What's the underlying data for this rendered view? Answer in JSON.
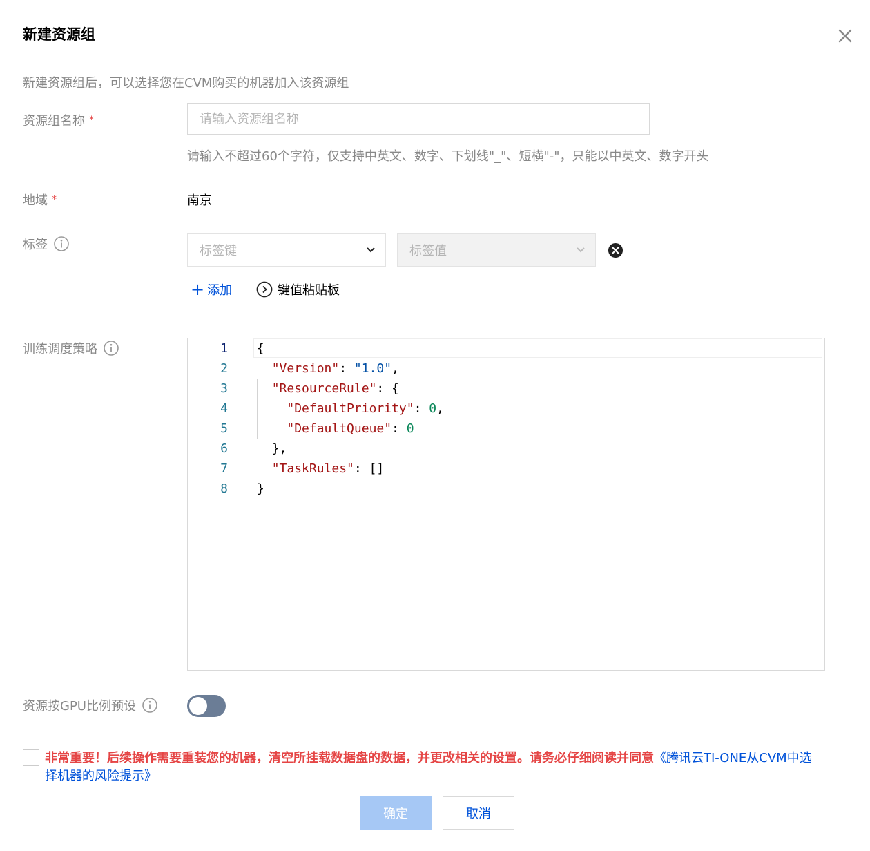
{
  "dialog": {
    "title": "新建资源组",
    "description": "新建资源组后，可以选择您在CVM购买的机器加入该资源组"
  },
  "form": {
    "name": {
      "label": "资源组名称",
      "required_mark": "*",
      "placeholder": "请输入资源组名称",
      "value": "",
      "hint": "请输入不超过60个字符，仅支持中英文、数字、下划线\"_\"、短横\"-\"，只能以中英文、数字开头"
    },
    "region": {
      "label": "地域",
      "required_mark": "*",
      "value": "南京"
    },
    "tags": {
      "label": "标签",
      "key_placeholder": "标签键",
      "value_placeholder": "标签值",
      "add_label": "添加",
      "paste_label": "键值粘贴板"
    },
    "policy": {
      "label": "训练调度策略",
      "line_numbers": [
        "1",
        "2",
        "3",
        "4",
        "5",
        "6",
        "7",
        "8"
      ],
      "code": {
        "l1_open": "{",
        "version_key": "\"Version\"",
        "colon": ": ",
        "version_val": "\"1.0\"",
        "comma": ",",
        "resource_rule_key": "\"ResourceRule\"",
        "open_brace": "{",
        "default_priority_key": "\"DefaultPriority\"",
        "default_priority_val": "0",
        "default_queue_key": "\"DefaultQueue\"",
        "default_queue_val": "0",
        "close_brace_comma": "},",
        "task_rules_key": "\"TaskRules\"",
        "task_rules_val": "[]",
        "l8_close": "}"
      }
    },
    "gpu_ratio": {
      "label": "资源按GPU比例预设",
      "enabled": false
    },
    "agreement": {
      "checked": false,
      "warning": "非常重要！后续操作需要重装您的机器，清空所挂载数据盘的数据，并更改相关的设置。请务必仔细阅读并同意",
      "link": "《腾讯云TI-ONE从CVM中选择机器的风险提示》"
    }
  },
  "buttons": {
    "confirm": "确定",
    "cancel": "取消"
  },
  "colors": {
    "primary": "#0052d9",
    "danger": "#e54545",
    "confirm_disabled": "#a6c8f5",
    "toggle_off": "#6b7d96"
  }
}
